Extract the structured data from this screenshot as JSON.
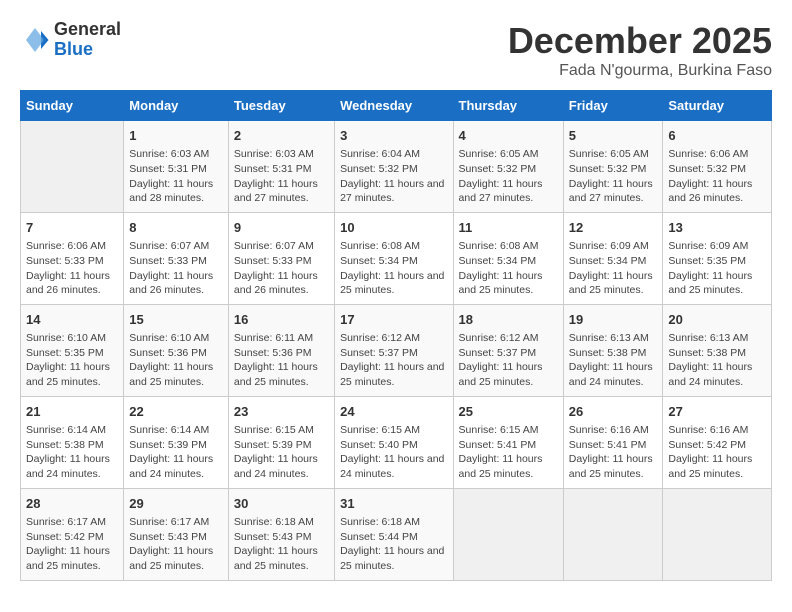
{
  "logo": {
    "general": "General",
    "blue": "Blue"
  },
  "title": "December 2025",
  "subtitle": "Fada N'gourma, Burkina Faso",
  "header_days": [
    "Sunday",
    "Monday",
    "Tuesday",
    "Wednesday",
    "Thursday",
    "Friday",
    "Saturday"
  ],
  "weeks": [
    [
      {
        "day": "",
        "sunrise": "",
        "sunset": "",
        "daylight": ""
      },
      {
        "day": "1",
        "sunrise": "Sunrise: 6:03 AM",
        "sunset": "Sunset: 5:31 PM",
        "daylight": "Daylight: 11 hours and 28 minutes."
      },
      {
        "day": "2",
        "sunrise": "Sunrise: 6:03 AM",
        "sunset": "Sunset: 5:31 PM",
        "daylight": "Daylight: 11 hours and 27 minutes."
      },
      {
        "day": "3",
        "sunrise": "Sunrise: 6:04 AM",
        "sunset": "Sunset: 5:32 PM",
        "daylight": "Daylight: 11 hours and 27 minutes."
      },
      {
        "day": "4",
        "sunrise": "Sunrise: 6:05 AM",
        "sunset": "Sunset: 5:32 PM",
        "daylight": "Daylight: 11 hours and 27 minutes."
      },
      {
        "day": "5",
        "sunrise": "Sunrise: 6:05 AM",
        "sunset": "Sunset: 5:32 PM",
        "daylight": "Daylight: 11 hours and 27 minutes."
      },
      {
        "day": "6",
        "sunrise": "Sunrise: 6:06 AM",
        "sunset": "Sunset: 5:32 PM",
        "daylight": "Daylight: 11 hours and 26 minutes."
      }
    ],
    [
      {
        "day": "7",
        "sunrise": "Sunrise: 6:06 AM",
        "sunset": "Sunset: 5:33 PM",
        "daylight": "Daylight: 11 hours and 26 minutes."
      },
      {
        "day": "8",
        "sunrise": "Sunrise: 6:07 AM",
        "sunset": "Sunset: 5:33 PM",
        "daylight": "Daylight: 11 hours and 26 minutes."
      },
      {
        "day": "9",
        "sunrise": "Sunrise: 6:07 AM",
        "sunset": "Sunset: 5:33 PM",
        "daylight": "Daylight: 11 hours and 26 minutes."
      },
      {
        "day": "10",
        "sunrise": "Sunrise: 6:08 AM",
        "sunset": "Sunset: 5:34 PM",
        "daylight": "Daylight: 11 hours and 25 minutes."
      },
      {
        "day": "11",
        "sunrise": "Sunrise: 6:08 AM",
        "sunset": "Sunset: 5:34 PM",
        "daylight": "Daylight: 11 hours and 25 minutes."
      },
      {
        "day": "12",
        "sunrise": "Sunrise: 6:09 AM",
        "sunset": "Sunset: 5:34 PM",
        "daylight": "Daylight: 11 hours and 25 minutes."
      },
      {
        "day": "13",
        "sunrise": "Sunrise: 6:09 AM",
        "sunset": "Sunset: 5:35 PM",
        "daylight": "Daylight: 11 hours and 25 minutes."
      }
    ],
    [
      {
        "day": "14",
        "sunrise": "Sunrise: 6:10 AM",
        "sunset": "Sunset: 5:35 PM",
        "daylight": "Daylight: 11 hours and 25 minutes."
      },
      {
        "day": "15",
        "sunrise": "Sunrise: 6:10 AM",
        "sunset": "Sunset: 5:36 PM",
        "daylight": "Daylight: 11 hours and 25 minutes."
      },
      {
        "day": "16",
        "sunrise": "Sunrise: 6:11 AM",
        "sunset": "Sunset: 5:36 PM",
        "daylight": "Daylight: 11 hours and 25 minutes."
      },
      {
        "day": "17",
        "sunrise": "Sunrise: 6:12 AM",
        "sunset": "Sunset: 5:37 PM",
        "daylight": "Daylight: 11 hours and 25 minutes."
      },
      {
        "day": "18",
        "sunrise": "Sunrise: 6:12 AM",
        "sunset": "Sunset: 5:37 PM",
        "daylight": "Daylight: 11 hours and 25 minutes."
      },
      {
        "day": "19",
        "sunrise": "Sunrise: 6:13 AM",
        "sunset": "Sunset: 5:38 PM",
        "daylight": "Daylight: 11 hours and 24 minutes."
      },
      {
        "day": "20",
        "sunrise": "Sunrise: 6:13 AM",
        "sunset": "Sunset: 5:38 PM",
        "daylight": "Daylight: 11 hours and 24 minutes."
      }
    ],
    [
      {
        "day": "21",
        "sunrise": "Sunrise: 6:14 AM",
        "sunset": "Sunset: 5:38 PM",
        "daylight": "Daylight: 11 hours and 24 minutes."
      },
      {
        "day": "22",
        "sunrise": "Sunrise: 6:14 AM",
        "sunset": "Sunset: 5:39 PM",
        "daylight": "Daylight: 11 hours and 24 minutes."
      },
      {
        "day": "23",
        "sunrise": "Sunrise: 6:15 AM",
        "sunset": "Sunset: 5:39 PM",
        "daylight": "Daylight: 11 hours and 24 minutes."
      },
      {
        "day": "24",
        "sunrise": "Sunrise: 6:15 AM",
        "sunset": "Sunset: 5:40 PM",
        "daylight": "Daylight: 11 hours and 24 minutes."
      },
      {
        "day": "25",
        "sunrise": "Sunrise: 6:15 AM",
        "sunset": "Sunset: 5:41 PM",
        "daylight": "Daylight: 11 hours and 25 minutes."
      },
      {
        "day": "26",
        "sunrise": "Sunrise: 6:16 AM",
        "sunset": "Sunset: 5:41 PM",
        "daylight": "Daylight: 11 hours and 25 minutes."
      },
      {
        "day": "27",
        "sunrise": "Sunrise: 6:16 AM",
        "sunset": "Sunset: 5:42 PM",
        "daylight": "Daylight: 11 hours and 25 minutes."
      }
    ],
    [
      {
        "day": "28",
        "sunrise": "Sunrise: 6:17 AM",
        "sunset": "Sunset: 5:42 PM",
        "daylight": "Daylight: 11 hours and 25 minutes."
      },
      {
        "day": "29",
        "sunrise": "Sunrise: 6:17 AM",
        "sunset": "Sunset: 5:43 PM",
        "daylight": "Daylight: 11 hours and 25 minutes."
      },
      {
        "day": "30",
        "sunrise": "Sunrise: 6:18 AM",
        "sunset": "Sunset: 5:43 PM",
        "daylight": "Daylight: 11 hours and 25 minutes."
      },
      {
        "day": "31",
        "sunrise": "Sunrise: 6:18 AM",
        "sunset": "Sunset: 5:44 PM",
        "daylight": "Daylight: 11 hours and 25 minutes."
      },
      {
        "day": "",
        "sunrise": "",
        "sunset": "",
        "daylight": ""
      },
      {
        "day": "",
        "sunrise": "",
        "sunset": "",
        "daylight": ""
      },
      {
        "day": "",
        "sunrise": "",
        "sunset": "",
        "daylight": ""
      }
    ]
  ]
}
